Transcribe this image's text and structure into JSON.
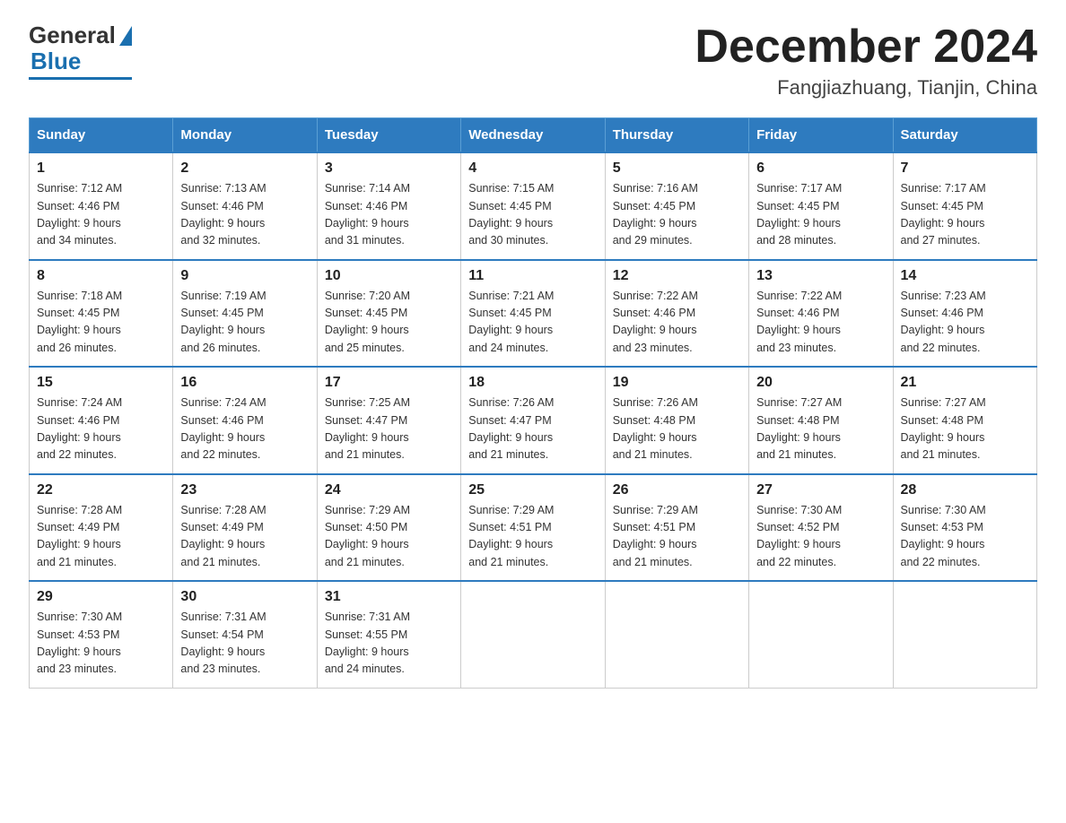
{
  "header": {
    "logo_general": "General",
    "logo_blue": "Blue",
    "month_title": "December 2024",
    "location": "Fangjiazhuang, Tianjin, China"
  },
  "days_of_week": [
    "Sunday",
    "Monday",
    "Tuesday",
    "Wednesday",
    "Thursday",
    "Friday",
    "Saturday"
  ],
  "weeks": [
    [
      {
        "day": "1",
        "sunrise": "7:12 AM",
        "sunset": "4:46 PM",
        "daylight": "9 hours and 34 minutes."
      },
      {
        "day": "2",
        "sunrise": "7:13 AM",
        "sunset": "4:46 PM",
        "daylight": "9 hours and 32 minutes."
      },
      {
        "day": "3",
        "sunrise": "7:14 AM",
        "sunset": "4:46 PM",
        "daylight": "9 hours and 31 minutes."
      },
      {
        "day": "4",
        "sunrise": "7:15 AM",
        "sunset": "4:45 PM",
        "daylight": "9 hours and 30 minutes."
      },
      {
        "day": "5",
        "sunrise": "7:16 AM",
        "sunset": "4:45 PM",
        "daylight": "9 hours and 29 minutes."
      },
      {
        "day": "6",
        "sunrise": "7:17 AM",
        "sunset": "4:45 PM",
        "daylight": "9 hours and 28 minutes."
      },
      {
        "day": "7",
        "sunrise": "7:17 AM",
        "sunset": "4:45 PM",
        "daylight": "9 hours and 27 minutes."
      }
    ],
    [
      {
        "day": "8",
        "sunrise": "7:18 AM",
        "sunset": "4:45 PM",
        "daylight": "9 hours and 26 minutes."
      },
      {
        "day": "9",
        "sunrise": "7:19 AM",
        "sunset": "4:45 PM",
        "daylight": "9 hours and 26 minutes."
      },
      {
        "day": "10",
        "sunrise": "7:20 AM",
        "sunset": "4:45 PM",
        "daylight": "9 hours and 25 minutes."
      },
      {
        "day": "11",
        "sunrise": "7:21 AM",
        "sunset": "4:45 PM",
        "daylight": "9 hours and 24 minutes."
      },
      {
        "day": "12",
        "sunrise": "7:22 AM",
        "sunset": "4:46 PM",
        "daylight": "9 hours and 23 minutes."
      },
      {
        "day": "13",
        "sunrise": "7:22 AM",
        "sunset": "4:46 PM",
        "daylight": "9 hours and 23 minutes."
      },
      {
        "day": "14",
        "sunrise": "7:23 AM",
        "sunset": "4:46 PM",
        "daylight": "9 hours and 22 minutes."
      }
    ],
    [
      {
        "day": "15",
        "sunrise": "7:24 AM",
        "sunset": "4:46 PM",
        "daylight": "9 hours and 22 minutes."
      },
      {
        "day": "16",
        "sunrise": "7:24 AM",
        "sunset": "4:46 PM",
        "daylight": "9 hours and 22 minutes."
      },
      {
        "day": "17",
        "sunrise": "7:25 AM",
        "sunset": "4:47 PM",
        "daylight": "9 hours and 21 minutes."
      },
      {
        "day": "18",
        "sunrise": "7:26 AM",
        "sunset": "4:47 PM",
        "daylight": "9 hours and 21 minutes."
      },
      {
        "day": "19",
        "sunrise": "7:26 AM",
        "sunset": "4:48 PM",
        "daylight": "9 hours and 21 minutes."
      },
      {
        "day": "20",
        "sunrise": "7:27 AM",
        "sunset": "4:48 PM",
        "daylight": "9 hours and 21 minutes."
      },
      {
        "day": "21",
        "sunrise": "7:27 AM",
        "sunset": "4:48 PM",
        "daylight": "9 hours and 21 minutes."
      }
    ],
    [
      {
        "day": "22",
        "sunrise": "7:28 AM",
        "sunset": "4:49 PM",
        "daylight": "9 hours and 21 minutes."
      },
      {
        "day": "23",
        "sunrise": "7:28 AM",
        "sunset": "4:49 PM",
        "daylight": "9 hours and 21 minutes."
      },
      {
        "day": "24",
        "sunrise": "7:29 AM",
        "sunset": "4:50 PM",
        "daylight": "9 hours and 21 minutes."
      },
      {
        "day": "25",
        "sunrise": "7:29 AM",
        "sunset": "4:51 PM",
        "daylight": "9 hours and 21 minutes."
      },
      {
        "day": "26",
        "sunrise": "7:29 AM",
        "sunset": "4:51 PM",
        "daylight": "9 hours and 21 minutes."
      },
      {
        "day": "27",
        "sunrise": "7:30 AM",
        "sunset": "4:52 PM",
        "daylight": "9 hours and 22 minutes."
      },
      {
        "day": "28",
        "sunrise": "7:30 AM",
        "sunset": "4:53 PM",
        "daylight": "9 hours and 22 minutes."
      }
    ],
    [
      {
        "day": "29",
        "sunrise": "7:30 AM",
        "sunset": "4:53 PM",
        "daylight": "9 hours and 23 minutes."
      },
      {
        "day": "30",
        "sunrise": "7:31 AM",
        "sunset": "4:54 PM",
        "daylight": "9 hours and 23 minutes."
      },
      {
        "day": "31",
        "sunrise": "7:31 AM",
        "sunset": "4:55 PM",
        "daylight": "9 hours and 24 minutes."
      },
      null,
      null,
      null,
      null
    ]
  ]
}
